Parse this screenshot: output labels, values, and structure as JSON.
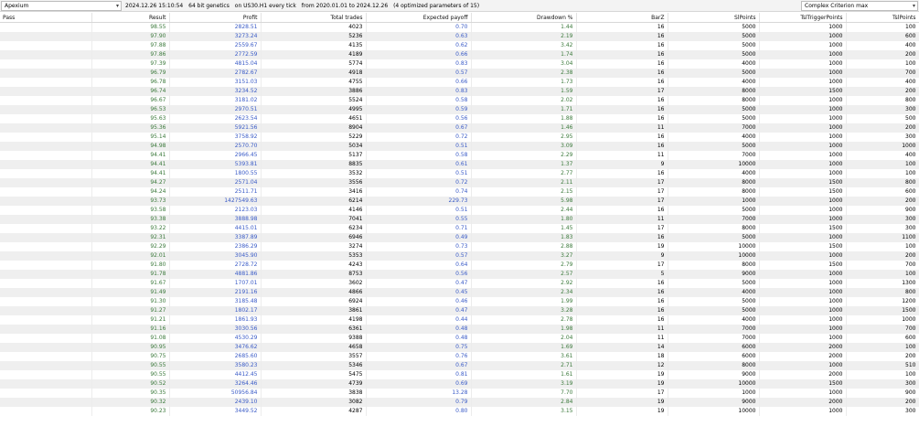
{
  "header": {
    "symbol_combo": "Apexium",
    "date": "2024.12.26 15:10:54",
    "mode": "64 bit genetics",
    "on": "on US30.H1 every tick",
    "from": "from 2020.01.01 to 2024.12.26",
    "params": "(4 optimized parameters of 15)",
    "criterion_combo": "Complex Criterion max"
  },
  "columns": [
    "Pass",
    "Result",
    "Profit",
    "Total trades",
    "Expected payoff",
    "Drawdown %",
    "BarZ",
    "SlPoints",
    "TslTriggerPoints",
    "TslPoints"
  ],
  "rows": [
    [
      "",
      "98.55",
      "2828.51",
      "4023",
      "0.70",
      "1.44",
      "16",
      "5000",
      "1000",
      "100"
    ],
    [
      "",
      "97.90",
      "3273.24",
      "5236",
      "0.63",
      "2.19",
      "16",
      "5000",
      "1000",
      "600"
    ],
    [
      "",
      "97.88",
      "2559.67",
      "4135",
      "0.62",
      "3.42",
      "16",
      "5000",
      "1000",
      "400"
    ],
    [
      "",
      "97.86",
      "2772.59",
      "4189",
      "0.66",
      "1.74",
      "16",
      "5000",
      "1000",
      "200"
    ],
    [
      "",
      "97.39",
      "4815.04",
      "5774",
      "0.83",
      "3.04",
      "16",
      "4000",
      "1000",
      "100"
    ],
    [
      "",
      "96.79",
      "2782.67",
      "4918",
      "0.57",
      "2.38",
      "16",
      "5000",
      "1000",
      "700"
    ],
    [
      "",
      "96.78",
      "3151.03",
      "4755",
      "0.66",
      "1.73",
      "16",
      "4000",
      "1000",
      "400"
    ],
    [
      "",
      "96.74",
      "3234.52",
      "3886",
      "0.83",
      "1.59",
      "17",
      "8000",
      "1500",
      "200"
    ],
    [
      "",
      "96.67",
      "3181.02",
      "5524",
      "0.58",
      "2.02",
      "16",
      "8000",
      "1000",
      "800"
    ],
    [
      "",
      "96.53",
      "2970.51",
      "4995",
      "0.59",
      "1.71",
      "16",
      "5000",
      "1000",
      "300"
    ],
    [
      "",
      "95.63",
      "2623.54",
      "4651",
      "0.56",
      "1.88",
      "16",
      "5000",
      "1000",
      "500"
    ],
    [
      "",
      "95.36",
      "5921.56",
      "8904",
      "0.67",
      "1.46",
      "11",
      "7000",
      "1000",
      "200"
    ],
    [
      "",
      "95.14",
      "3758.92",
      "5229",
      "0.72",
      "2.95",
      "16",
      "4000",
      "1000",
      "300"
    ],
    [
      "",
      "94.98",
      "2570.70",
      "5034",
      "0.51",
      "3.09",
      "16",
      "5000",
      "1000",
      "1000"
    ],
    [
      "",
      "94.41",
      "2966.45",
      "5137",
      "0.58",
      "2.29",
      "11",
      "7000",
      "1000",
      "400"
    ],
    [
      "",
      "94.41",
      "5393.81",
      "8835",
      "0.61",
      "1.37",
      "9",
      "10000",
      "1000",
      "100"
    ],
    [
      "",
      "94.41",
      "1800.55",
      "3532",
      "0.51",
      "2.77",
      "16",
      "4000",
      "1000",
      "100"
    ],
    [
      "",
      "94.27",
      "2571.04",
      "3556",
      "0.72",
      "2.11",
      "17",
      "8000",
      "1500",
      "800"
    ],
    [
      "",
      "94.24",
      "2511.71",
      "3416",
      "0.74",
      "2.15",
      "17",
      "8000",
      "1500",
      "600"
    ],
    [
      "",
      "93.73",
      "1427549.63",
      "6214",
      "229.73",
      "5.98",
      "17",
      "1000",
      "1000",
      "200"
    ],
    [
      "",
      "93.58",
      "2123.03",
      "4146",
      "0.51",
      "2.44",
      "16",
      "5000",
      "1000",
      "900"
    ],
    [
      "",
      "93.38",
      "3888.98",
      "7041",
      "0.55",
      "1.80",
      "11",
      "7000",
      "1000",
      "300"
    ],
    [
      "",
      "93.22",
      "4415.01",
      "6234",
      "0.71",
      "1.45",
      "17",
      "8000",
      "1500",
      "300"
    ],
    [
      "",
      "92.31",
      "3387.89",
      "6946",
      "0.49",
      "1.83",
      "16",
      "5000",
      "1000",
      "1100"
    ],
    [
      "",
      "92.29",
      "2386.29",
      "3274",
      "0.73",
      "2.88",
      "19",
      "10000",
      "1500",
      "100"
    ],
    [
      "",
      "92.01",
      "3045.90",
      "5353",
      "0.57",
      "3.27",
      "9",
      "10000",
      "1000",
      "200"
    ],
    [
      "",
      "91.80",
      "2728.72",
      "4243",
      "0.64",
      "2.79",
      "17",
      "8000",
      "1500",
      "700"
    ],
    [
      "",
      "91.78",
      "4881.86",
      "8753",
      "0.56",
      "2.57",
      "5",
      "9000",
      "1000",
      "100"
    ],
    [
      "",
      "91.67",
      "1707.01",
      "3602",
      "0.47",
      "2.92",
      "16",
      "5000",
      "1000",
      "1300"
    ],
    [
      "",
      "91.49",
      "2191.16",
      "4866",
      "0.45",
      "2.34",
      "16",
      "4000",
      "1000",
      "800"
    ],
    [
      "",
      "91.30",
      "3185.48",
      "6924",
      "0.46",
      "1.99",
      "16",
      "5000",
      "1000",
      "1200"
    ],
    [
      "",
      "91.27",
      "1802.17",
      "3861",
      "0.47",
      "3.28",
      "16",
      "5000",
      "1000",
      "1500"
    ],
    [
      "",
      "91.21",
      "1861.93",
      "4198",
      "0.44",
      "2.78",
      "16",
      "4000",
      "1000",
      "1000"
    ],
    [
      "",
      "91.16",
      "3030.56",
      "6361",
      "0.48",
      "1.98",
      "11",
      "7000",
      "1000",
      "700"
    ],
    [
      "",
      "91.08",
      "4530.29",
      "9388",
      "0.48",
      "2.04",
      "11",
      "7000",
      "1000",
      "600"
    ],
    [
      "",
      "90.95",
      "3476.62",
      "4658",
      "0.75",
      "1.69",
      "14",
      "6000",
      "2000",
      "100"
    ],
    [
      "",
      "90.75",
      "2685.60",
      "3557",
      "0.76",
      "3.61",
      "18",
      "6000",
      "2000",
      "200"
    ],
    [
      "",
      "90.55",
      "3580.23",
      "5346",
      "0.67",
      "2.71",
      "12",
      "8000",
      "1000",
      "510"
    ],
    [
      "",
      "90.55",
      "4412.45",
      "5475",
      "0.81",
      "1.61",
      "19",
      "9000",
      "2000",
      "100"
    ],
    [
      "",
      "90.52",
      "3264.46",
      "4739",
      "0.69",
      "3.19",
      "19",
      "10000",
      "1500",
      "300"
    ],
    [
      "",
      "90.35",
      "50956.84",
      "3838",
      "13.28",
      "7.70",
      "17",
      "1000",
      "1000",
      "900"
    ],
    [
      "",
      "90.32",
      "2439.10",
      "3082",
      "0.79",
      "2.84",
      "19",
      "9000",
      "2000",
      "200"
    ],
    [
      "",
      "90.23",
      "3449.52",
      "4287",
      "0.80",
      "3.15",
      "19",
      "10000",
      "1000",
      "300"
    ]
  ]
}
